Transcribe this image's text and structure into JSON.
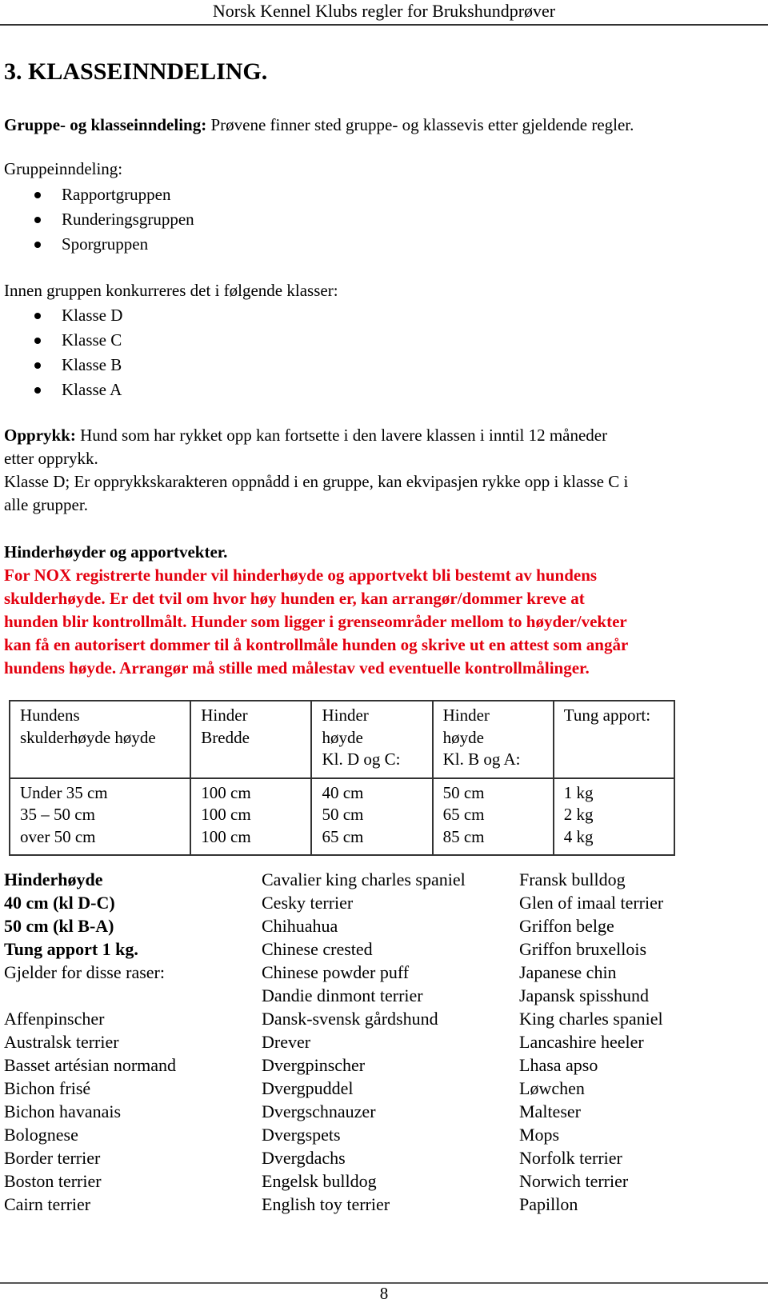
{
  "header": {
    "title": "Norsk Kennel Klubs regler for Brukshundprøver"
  },
  "section_title": "3. KLASSEINNDELING.",
  "intro": {
    "label": "Gruppe- og klasseinndeling:",
    "text": " Prøvene finner sted gruppe- og klassevis etter gjeldende regler."
  },
  "groups": {
    "label": "Gruppeinndeling:",
    "items": [
      "Rapportgruppen",
      "Runderingsgruppen",
      "Sporgruppen"
    ]
  },
  "classes": {
    "label": "Innen gruppen konkurreres det i følgende klasser:",
    "items": [
      "Klasse D",
      "Klasse C",
      "Klasse B",
      "Klasse A"
    ]
  },
  "promotion": {
    "label": "Opprykk:",
    "line1": " Hund som har rykket opp kan fortsette i den lavere klassen i inntil 12 måneder",
    "line2": "etter opprykk.",
    "line3": "Klasse D; Er opprykkskarakteren oppnådd i en gruppe, kan ekvipasjen rykke opp i klasse C i",
    "line4": "alle grupper."
  },
  "obstacles": {
    "heading": "Hinderhøyder og apportvekter.",
    "notice_lines": [
      "For NOX registrerte hunder vil hinderhøyde og apportvekt bli bestemt av hundens",
      "skulderhøyde. Er det tvil om hvor høy hunden er, kan arrangør/dommer kreve at",
      "hunden blir kontrollmålt. Hunder som ligger i grenseområder mellom to høyder/vekter",
      "kan få en autorisert dommer til å kontrollmåle hunden og skrive ut en attest som angår",
      "hundens høyde. Arrangør må stille med målestav ved eventuelle kontrollmålinger."
    ],
    "notice_color": "#e3000f"
  },
  "table": {
    "headers": [
      [
        "Hundens",
        "skulderhøyde høyde"
      ],
      [
        "Hinder",
        "Bredde"
      ],
      [
        "Hinder",
        "høyde",
        "Kl. D og C:"
      ],
      [
        "Hinder",
        "høyde",
        "Kl. B og A:"
      ],
      [
        "Tung apport:"
      ]
    ],
    "columns": [
      [
        "Under 35 cm",
        "35 – 50 cm",
        "over 50 cm"
      ],
      [
        "100 cm",
        "100 cm",
        "100 cm"
      ],
      [
        "40 cm",
        "50 cm",
        "65 cm"
      ],
      [
        "50 cm",
        "65 cm",
        "85 cm"
      ],
      [
        "1 kg",
        "2 kg",
        "4 kg"
      ]
    ]
  },
  "breeds": {
    "rule_lines": [
      "Hinderhøyde",
      "40 cm (kl D-C)",
      "50 cm (kl B-A)",
      "Tung apport 1 kg."
    ],
    "applies_label": "Gjelder for disse raser:",
    "col1": [
      "Affenpinscher",
      "Australsk terrier",
      "Basset artésian normand",
      "Bichon frisé",
      "Bichon havanais",
      "Bolognese",
      "Border terrier",
      "Boston terrier",
      "Cairn terrier"
    ],
    "col2": [
      "Cavalier king charles spaniel",
      "Cesky terrier",
      "Chihuahua",
      "Chinese crested",
      "Chinese powder puff",
      "Dandie dinmont terrier",
      "Dansk-svensk gårdshund",
      "Drever",
      "Dvergpinscher",
      "Dvergpuddel",
      "Dvergschnauzer",
      "Dvergspets",
      "Dvergdachs",
      "Engelsk bulldog",
      "English toy terrier"
    ],
    "col3": [
      "Fransk bulldog",
      "Glen of imaal terrier",
      "Griffon belge",
      "Griffon bruxellois",
      "Japanese chin",
      "Japansk spisshund",
      "King charles spaniel",
      "Lancashire heeler",
      "Lhasa apso",
      "Løwchen",
      "Malteser",
      "Mops",
      "Norfolk terrier",
      "Norwich terrier",
      "Papillon"
    ]
  },
  "footer": {
    "page_number": "8"
  }
}
